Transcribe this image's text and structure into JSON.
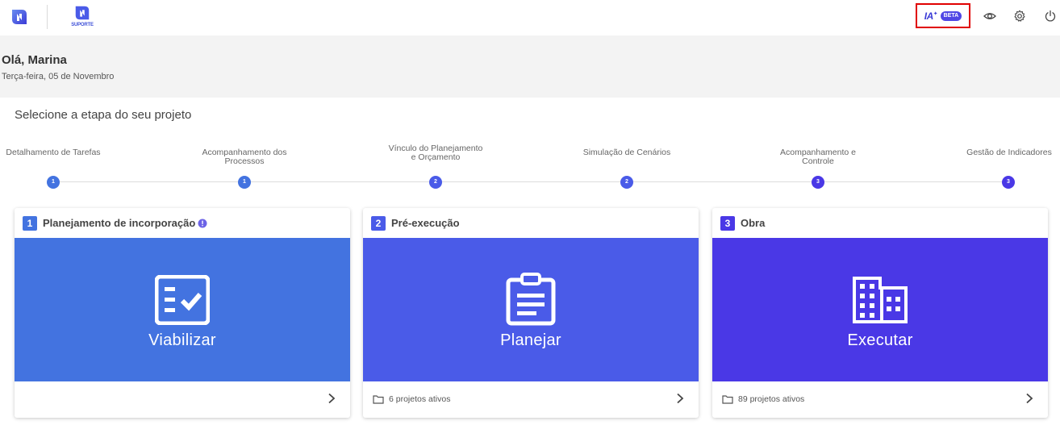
{
  "header": {
    "support_label": "SUPORTE",
    "ia_label": "IA",
    "ia_spark": "✦",
    "beta_label": "BETA",
    "icons": [
      "brand-logo-icon",
      "support-logo-icon",
      "eye-icon",
      "gear-icon",
      "power-icon"
    ]
  },
  "greeting": {
    "title": "Olá, Marina",
    "date": "Terça-feira, 05 de Novembro"
  },
  "main": {
    "title": "Selecione a etapa do seu projeto"
  },
  "steps": [
    {
      "label": "Detalhamento de Tarefas",
      "number": "1"
    },
    {
      "label": "Acompanhamento dos Processos",
      "number": "1"
    },
    {
      "label": "Vínculo do Planejamento e Orçamento",
      "number": "2"
    },
    {
      "label": "Simulação de Cenários",
      "number": "2"
    },
    {
      "label": "Acompanhamento e Controle",
      "number": "3"
    },
    {
      "label": "Gestão de Indicadores",
      "number": "3"
    }
  ],
  "cards": [
    {
      "number": "1",
      "title": "Planejamento de incorporação",
      "action": "Viabilizar",
      "footer": "",
      "color": "#4373e0"
    },
    {
      "number": "2",
      "title": "Pré-execução",
      "action": "Planejar",
      "footer": "6 projetos ativos",
      "color": "#4a5be8"
    },
    {
      "number": "3",
      "title": "Obra",
      "action": "Executar",
      "footer": "89 projetos ativos",
      "color": "#4a38e6"
    }
  ],
  "colors": {
    "step1": "#4373e0",
    "step2": "#4a5be8",
    "step3": "#4a38e6",
    "highlight": "#e00000"
  }
}
